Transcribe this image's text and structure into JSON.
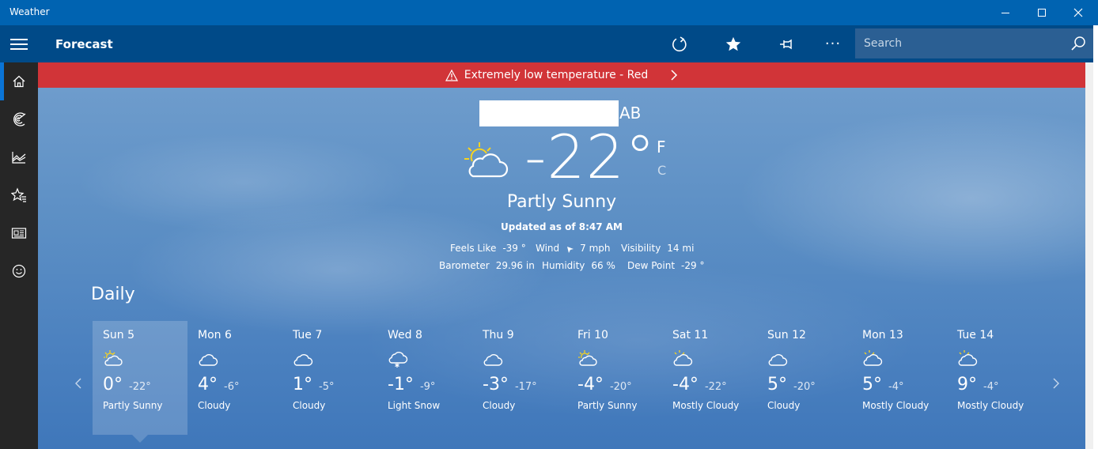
{
  "window": {
    "title": "Weather"
  },
  "header": {
    "title": "Forecast",
    "more_label": "···",
    "search_placeholder": "Search"
  },
  "alert": {
    "text": "Extremely low temperature - Red"
  },
  "current": {
    "location_suffix": "AB",
    "temperature": "-22°",
    "unit_f": "F",
    "unit_c": "C",
    "condition": "Partly Sunny",
    "updated": "Updated as of 8:47 AM",
    "details": {
      "feels_like_label": "Feels Like",
      "feels_like": "-39 °",
      "wind_label": "Wind",
      "wind": "7 mph",
      "visibility_label": "Visibility",
      "visibility": "14 mi",
      "barometer_label": "Barometer",
      "barometer": "29.96 in",
      "humidity_label": "Humidity",
      "humidity": "66 %",
      "dew_point_label": "Dew Point",
      "dew_point": "-29 °"
    }
  },
  "daily": {
    "title": "Daily",
    "days": [
      {
        "name": "Sun 5",
        "hi": "0°",
        "lo": "-22°",
        "cond": "Partly Sunny",
        "icon": "partly-sunny-icon"
      },
      {
        "name": "Mon 6",
        "hi": "4°",
        "lo": "-6°",
        "cond": "Cloudy",
        "icon": "cloudy-icon"
      },
      {
        "name": "Tue 7",
        "hi": "1°",
        "lo": "-5°",
        "cond": "Cloudy",
        "icon": "cloudy-icon"
      },
      {
        "name": "Wed 8",
        "hi": "-1°",
        "lo": "-9°",
        "cond": "Light Snow",
        "icon": "light-snow-icon"
      },
      {
        "name": "Thu 9",
        "hi": "-3°",
        "lo": "-17°",
        "cond": "Cloudy",
        "icon": "cloudy-icon"
      },
      {
        "name": "Fri 10",
        "hi": "-4°",
        "lo": "-20°",
        "cond": "Partly Sunny",
        "icon": "partly-sunny-icon"
      },
      {
        "name": "Sat 11",
        "hi": "-4°",
        "lo": "-22°",
        "cond": "Mostly Cloudy",
        "icon": "mostly-cloudy-icon"
      },
      {
        "name": "Sun 12",
        "hi": "5°",
        "lo": "-20°",
        "cond": "Cloudy",
        "icon": "cloudy-icon"
      },
      {
        "name": "Mon 13",
        "hi": "5°",
        "lo": "-4°",
        "cond": "Mostly Cloudy",
        "icon": "mostly-cloudy-icon"
      },
      {
        "name": "Tue 14",
        "hi": "9°",
        "lo": "-4°",
        "cond": "Mostly Cloudy",
        "icon": "mostly-cloudy-icon"
      }
    ]
  },
  "colors": {
    "titlebar": "#0063b1",
    "header": "#004a88",
    "alert": "#d13438",
    "nav": "#262626",
    "accent": "#0a74d6"
  }
}
